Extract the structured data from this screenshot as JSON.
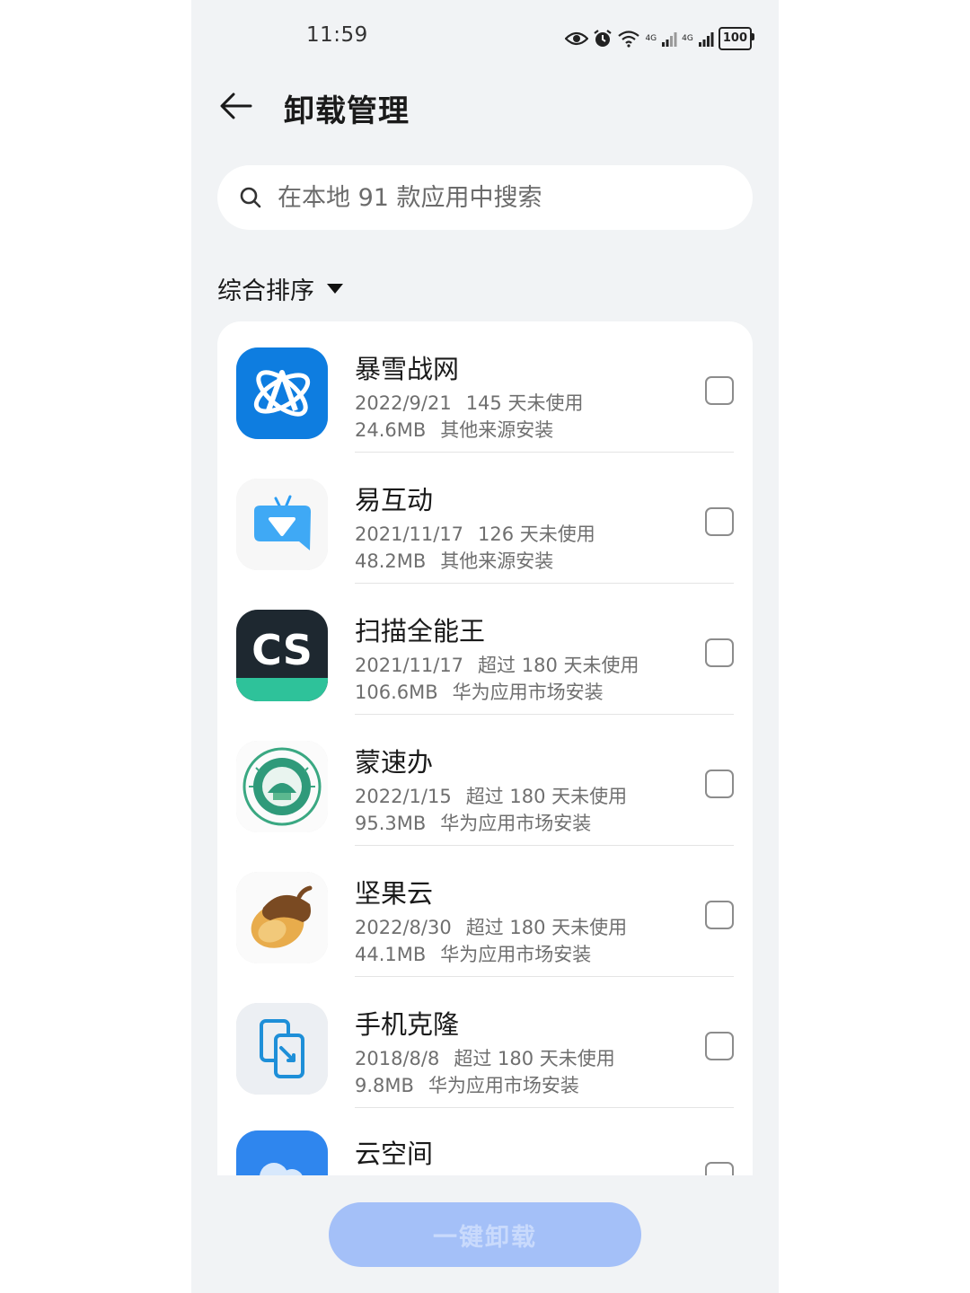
{
  "status_bar": {
    "time": "11:59",
    "net_label_1": "4G",
    "net_label_2": "4G",
    "battery": "100"
  },
  "header": {
    "title": "卸载管理"
  },
  "search": {
    "placeholder": "在本地 91 款应用中搜索"
  },
  "sort": {
    "label": "综合排序"
  },
  "apps": [
    {
      "name": "暴雪战网",
      "date": "2022/9/21",
      "usage": "145 天未使用",
      "size": "24.6MB",
      "source": "其他来源安装",
      "icon": "battlenet-icon",
      "checked": false
    },
    {
      "name": "易互动",
      "date": "2021/11/17",
      "usage": "126 天未使用",
      "size": "48.2MB",
      "source": "其他来源安装",
      "icon": "yihudong-icon",
      "checked": false
    },
    {
      "name": "扫描全能王",
      "date": "2021/11/17",
      "usage": "超过 180 天未使用",
      "size": "106.6MB",
      "source": "华为应用市场安装",
      "icon": "camscanner-icon",
      "checked": false,
      "icon_text": "CS"
    },
    {
      "name": "蒙速办",
      "date": "2022/1/15",
      "usage": "超过 180 天未使用",
      "size": "95.3MB",
      "source": "华为应用市场安装",
      "icon": "mengsuban-icon",
      "checked": false
    },
    {
      "name": "坚果云",
      "date": "2022/8/30",
      "usage": "超过 180 天未使用",
      "size": "44.1MB",
      "source": "华为应用市场安装",
      "icon": "acorn-icon",
      "checked": false
    },
    {
      "name": "手机克隆",
      "date": "2018/8/8",
      "usage": "超过 180 天未使用",
      "size": "9.8MB",
      "source": "华为应用市场安装",
      "icon": "phone-clone-icon",
      "checked": false
    },
    {
      "name": "云空间",
      "icon": "cloud-icon",
      "checked": false
    }
  ],
  "footer": {
    "uninstall_label": "一键卸载"
  },
  "colors": {
    "page_bg": "#f1f3f5",
    "button_disabled": "#a4c0f8",
    "accent_blue": "#1a73e8",
    "cs_green": "#2ec29a"
  }
}
